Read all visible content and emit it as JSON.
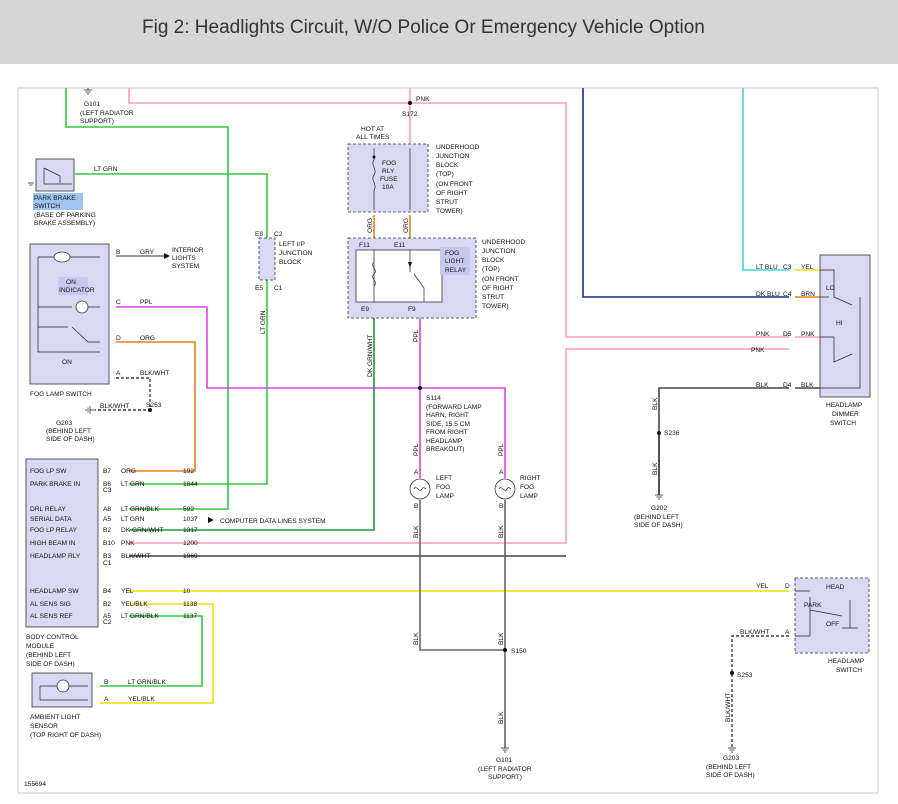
{
  "header": {
    "title": "Fig 2: Headlights Circuit, W/O Police Or Emergency Vehicle Option"
  },
  "colors": {
    "lt_grn": "#2ecc40",
    "pink": "#ff99c2",
    "lt_blu": "#3fd6e0",
    "dk_blu": "#1a2a8a",
    "orange": "#f07e1a",
    "purple": "#e040e0",
    "yellow": "#f2e200",
    "dk_grn": "#1e9a3a",
    "black": "#444444",
    "grey": "#777777",
    "component_fill": "#d9d9f3"
  },
  "ground_g101_top": {
    "name": "G101",
    "desc1": "(LEFT RADIATOR",
    "desc2": "SUPPORT)"
  },
  "splice_s172": {
    "name": "S172",
    "wire": "PNK"
  },
  "park_brake": {
    "label1": "PARK BRAKE",
    "label2": "SWITCH",
    "desc1": "(BASE OF PARKING",
    "desc2": "BRAKE ASSEMBLY)",
    "wire": "LT GRN"
  },
  "fog_lamp_switch": {
    "name": "FOG LAMP SWITCH",
    "on_indicator1": "ON",
    "on_indicator2": "INDICATOR",
    "on": "ON",
    "pins": [
      {
        "pin": "B",
        "wire": "GRY"
      },
      {
        "pin": "C",
        "wire": "PPL"
      },
      {
        "pin": "D",
        "wire": "ORG"
      },
      {
        "pin": "A",
        "wire": "BLK/WHT"
      }
    ]
  },
  "interior_lights": {
    "l1": "INTERIOR",
    "l2": "LIGHTS",
    "l3": "SYSTEM"
  },
  "splice_s253_left": {
    "name": "S253",
    "wire": "BLK/WHT"
  },
  "ground_g203_left": {
    "name": "G203",
    "desc1": "(BEHIND LEFT",
    "desc2": "SIDE OF DASH)"
  },
  "left_ip_junction": {
    "l1": "LEFT I/P",
    "l2": "JUNCTION",
    "l3": "BLOCK",
    "pin_e8": "E8",
    "pin_c2": "C2",
    "pin_e5": "E5",
    "pin_c1": "C1",
    "wire": "LT GRN"
  },
  "hot_at_all_times": {
    "l1": "HOT AT",
    "l2": "ALL TIMES"
  },
  "fuse_box": {
    "l1": "FOG",
    "l2": "RLY",
    "l3": "FUSE",
    "l4": "10A"
  },
  "underhood_top": {
    "l1": "UNDERHOOD",
    "l2": "JUNCTION",
    "l3": "BLOCK",
    "l4": "(TOP)",
    "l5": "(ON FRONT",
    "l6": "OF RIGHT",
    "l7": "STRUT",
    "l8": "TOWER)"
  },
  "relay_box": {
    "f11": "F11",
    "e11": "E11",
    "e9": "E9",
    "f9": "F9",
    "relay1": "FOG",
    "relay2": "LIGHT",
    "relay3": "RELAY",
    "org1": "ORG",
    "org2": "ORG",
    "dkgrn": "DK GRN/WHT",
    "ppl": "PPL"
  },
  "underhood_relay": {
    "l1": "UNDERHOOD",
    "l2": "JUNCTION",
    "l3": "BLOCK",
    "l4": "(TOP)",
    "l5": "(ON FRONT",
    "l6": "OF RIGHT",
    "l7": "STRUT",
    "l8": "TOWER)"
  },
  "splice_s114": {
    "name": "S114",
    "l1": "(FORWARD LAMP",
    "l2": "HARN, RIGHT",
    "l3": "SIDE, 15.5 CM",
    "l4": "FROM RIGHT",
    "l5": "HEADLAMP",
    "l6": "BREAKOUT)"
  },
  "left_fog": {
    "l1": "LEFT",
    "l2": "FOG",
    "l3": "LAMP",
    "wire_a": "PPL",
    "pin_a": "A",
    "pin_b": "B",
    "wire_b": "BLK"
  },
  "right_fog": {
    "l1": "RIGHT",
    "l2": "FOG",
    "l3": "LAMP",
    "wire_a": "PPL",
    "pin_a": "A",
    "pin_b": "B",
    "wire_b": "BLK"
  },
  "splice_s150": {
    "name": "S150",
    "wire_l": "BLK",
    "wire_r": "BLK",
    "wire_d": "BLK"
  },
  "ground_g101_bottom": {
    "name": "G101",
    "desc1": "(LEFT RADIATOR",
    "desc2": "SUPPORT)"
  },
  "bcm": {
    "l1": "BODY CONTROL",
    "l2": "MODULE",
    "l3": "(BEHIND LEFT",
    "l4": "SIDE OF DASH)",
    "rows": [
      {
        "label": "FOG LP SW",
        "pin": "B7",
        "wire": "ORG",
        "circuit": "192"
      },
      {
        "label": "PARK BRAKE IN",
        "pin": "B6",
        "wire": "LT GRN",
        "circuit": "1844"
      },
      {
        "label": "",
        "pin": "C3",
        "wire": "",
        "circuit": ""
      },
      {
        "label": "DRL RELAY",
        "pin": "A8",
        "wire": "LT GRN/BLK",
        "circuit": "592"
      },
      {
        "label": "SERIAL DATA",
        "pin": "A5",
        "wire": "LT GRN",
        "circuit": "1037"
      },
      {
        "label": "FOG LP RELAY",
        "pin": "B2",
        "wire": "DK GRN/WHT",
        "circuit": "1317"
      },
      {
        "label": "HIGH BEAM IN",
        "pin": "B10",
        "wire": "PNK",
        "circuit": "1200"
      },
      {
        "label": "HEADLAMP RLY",
        "pin": "B3",
        "wire": "BLK/WHT",
        "circuit": "1969"
      },
      {
        "label": "",
        "pin": "C1",
        "wire": "",
        "circuit": ""
      },
      {
        "label": "HEADLAMP SW",
        "pin": "B4",
        "wire": "YEL",
        "circuit": "10"
      },
      {
        "label": "AL SENS SIG",
        "pin": "B2",
        "wire": "YEL/BLK",
        "circuit": "1138"
      },
      {
        "label": "AL SENS REF",
        "pin": "A5",
        "wire": "LT GRN/BLK",
        "circuit": "1137"
      },
      {
        "label": "",
        "pin": "C2",
        "wire": "",
        "circuit": ""
      }
    ]
  },
  "computer_data": "COMPUTER DATA LINES SYSTEM",
  "ambient": {
    "l1": "AMBIENT LIGHT",
    "l2": "SENSOR",
    "l3": "(TOP RIGHT OF DASH)",
    "pin_b": "B",
    "wire_b": "LT GRN/BLK",
    "pin_a": "A",
    "wire_a": "YEL/BLK"
  },
  "dimmer": {
    "l1": "HEADLAMP",
    "l2": "DIMMER",
    "l3": "SWITCH",
    "lo": "LO",
    "hi": "HI",
    "pins": [
      {
        "pin": "C3",
        "wire_l": "LT BLU",
        "wire_r": "YEL"
      },
      {
        "pin": "C4",
        "wire_l": "DK BLU",
        "wire_r": "BRN"
      },
      {
        "pin": "D5",
        "wire_l": "PNK",
        "wire_r": "PNK"
      },
      {
        "pin": "D4",
        "wire_l": "BLK",
        "wire_r": "BLK"
      }
    ],
    "pnk2": "PNK"
  },
  "splice_s236": {
    "name": "S236",
    "wire_up": "BLK",
    "wire_dn": "BLK"
  },
  "ground_g202": {
    "name": "G202",
    "desc1": "(BEHIND LEFT",
    "desc2": "SIDE OF DASH)"
  },
  "headlamp_switch": {
    "l1": "HEADLAMP",
    "l2": "SWITCH",
    "head": "HEAD",
    "park": "PARK",
    "off": "OFF",
    "pin_d": "D",
    "wire_d": "YEL",
    "pin_a": "A",
    "wire_a": "BLK/WHT"
  },
  "splice_s253_right": {
    "name": "S253",
    "wire": "BLK/WHT"
  },
  "ground_g203_right": {
    "name": "G203",
    "desc1": "(BEHIND LEFT",
    "desc2": "SIDE OF DASH)"
  },
  "figure_number": "155694"
}
